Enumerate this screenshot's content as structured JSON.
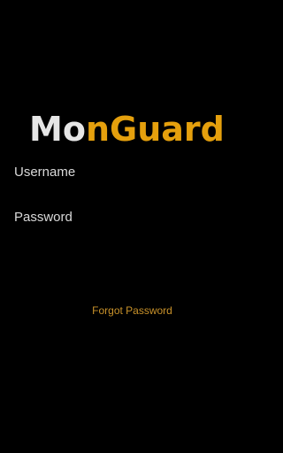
{
  "logo": {
    "part1": "M",
    "part2": "o",
    "part3": "n",
    "part4": "Guard",
    "color_light": "#e6e6e6",
    "color_brand": "#e5a00d"
  },
  "form": {
    "username_label": "Username",
    "password_label": "Password"
  },
  "links": {
    "forgot_password": "Forgot Password"
  },
  "theme": {
    "background": "#000000",
    "label_color": "#d9d9d9",
    "link_color": "#c9922a"
  }
}
